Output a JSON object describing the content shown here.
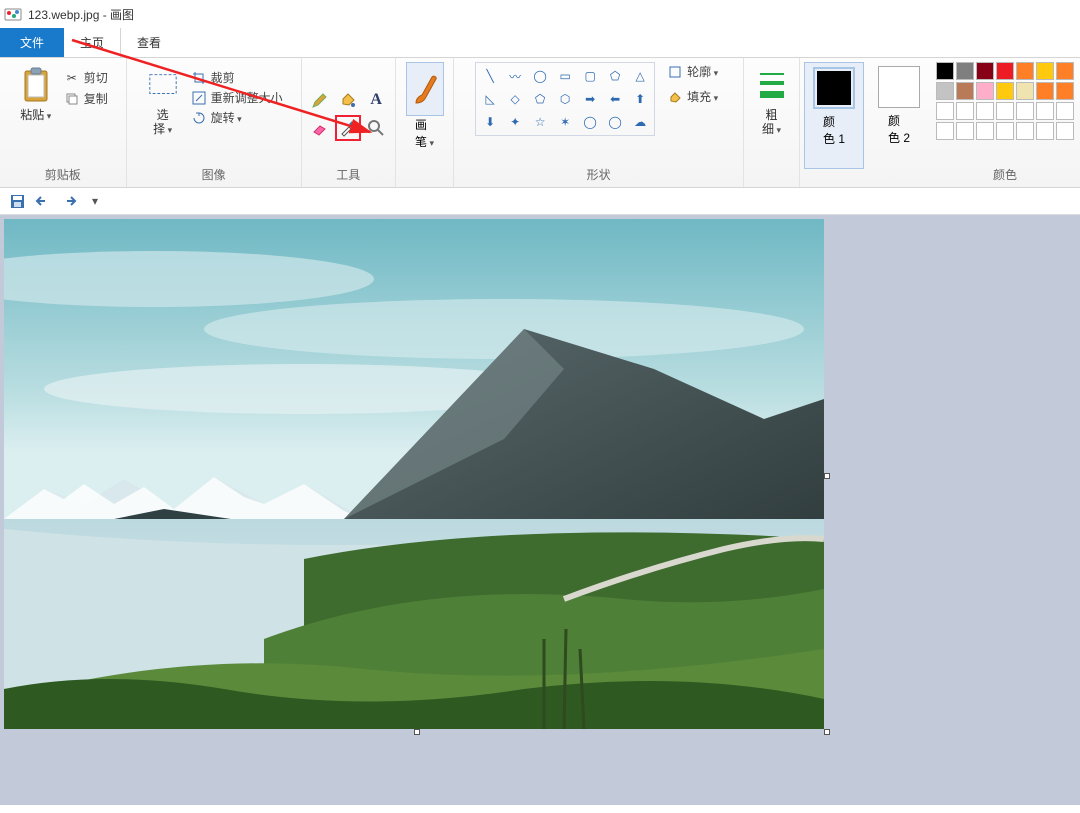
{
  "title": "123.webp.jpg - 画图",
  "menu": {
    "file": "文件",
    "home": "主页",
    "view": "查看"
  },
  "ribbon": {
    "clipboard": {
      "label": "剪贴板",
      "paste": "粘贴",
      "cut": "剪切",
      "copy": "复制"
    },
    "image": {
      "label": "图像",
      "select": "选\n择",
      "crop": "裁剪",
      "resize": "重新调整大小",
      "rotate": "旋转"
    },
    "tools": {
      "label": "工具",
      "pencil": "pencil-icon",
      "fill": "fill-icon",
      "text": "text-icon",
      "eraser": "eraser-icon",
      "picker": "color-picker-icon",
      "zoom": "magnifier-icon"
    },
    "brush": {
      "label": "画\n笔"
    },
    "shapes": {
      "label": "形状",
      "outline": "轮廓",
      "fill": "填充"
    },
    "size": {
      "label": "粗\n细"
    },
    "color1": {
      "label": "颜\n色 1"
    },
    "color2": {
      "label": "颜\n色 2"
    },
    "colors_label": "颜色",
    "palette": [
      "#000000",
      "#7f7f7f",
      "#880015",
      "#ed1c24",
      "#ff7f27",
      "#ffc90e",
      "#ff7f27",
      "#c3c3c3",
      "#b97a57",
      "#ffaec9",
      "#ffc90e",
      "#efe4b0",
      "#ff7f27",
      "#ff7f27",
      "#ffffff",
      "#ffffff",
      "#ffffff",
      "#ffffff",
      "#ffffff",
      "#ffffff",
      "#ffffff",
      "#ffffff",
      "#ffffff",
      "#ffffff",
      "#ffffff",
      "#ffffff",
      "#ffffff",
      "#ffffff"
    ]
  },
  "qat": {
    "save": "save-icon",
    "undo": "undo-icon",
    "redo": "redo-icon"
  }
}
